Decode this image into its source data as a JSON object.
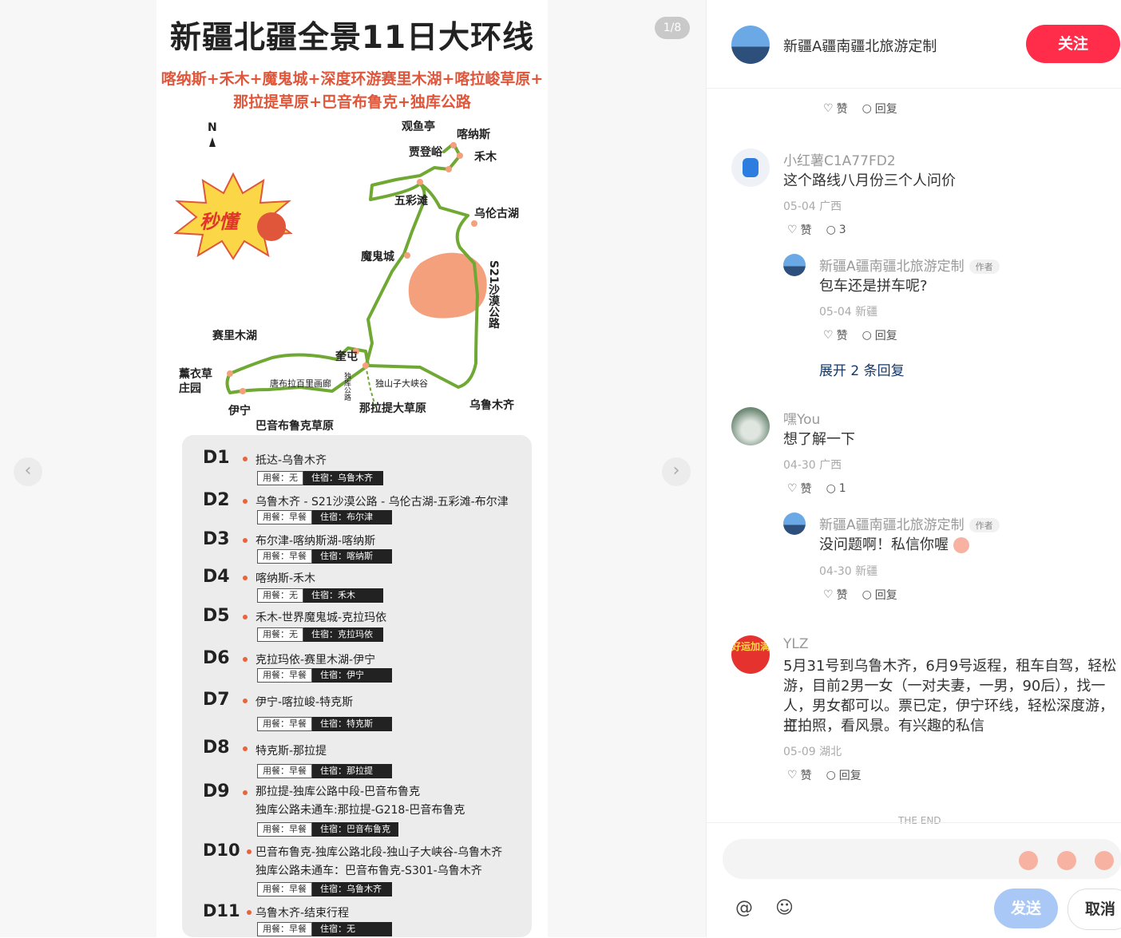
{
  "viewer": {
    "counter": "1/8",
    "prev_icon": "chevron-left-icon",
    "next_icon": "chevron-right-icon"
  },
  "poster": {
    "title": "新疆北疆全景11日大环线",
    "subtitle_line1": "喀纳斯+禾木+魔鬼城+深度环游赛里木湖+喀拉峻草原+",
    "subtitle_line2": "那拉提草原+巴音布鲁克+独库公路",
    "north": "N",
    "badge_text": "秒懂",
    "map_labels": {
      "guanyuting": "观鱼亭",
      "kanasi": "喀纳斯",
      "jiadengyu": "贾登峪",
      "hemu": "禾木",
      "wucaitan": "五彩滩",
      "wulungu": "乌伦古湖",
      "moguicheng": "魔鬼城",
      "s21": "S21沙漠公路",
      "sailimu": "赛里木湖",
      "kuitun": "奎屯",
      "xunyicao": "薰衣草庄园",
      "tangbula": "唐布拉百里画廊",
      "duku": "独库公路",
      "dushanzi": "独山子大峡谷",
      "yining": "伊宁",
      "nalati": "那拉提大草原",
      "bayinbuluke": "巴音布鲁克草原",
      "wulumuqi": "乌鲁木齐"
    },
    "days": [
      {
        "day": "D1",
        "route": "抵达-乌鲁木齐",
        "meal": "用餐：无",
        "stay": "住宿：乌鲁木齐"
      },
      {
        "day": "D2",
        "route": "乌鲁木齐 - S21沙漠公路 - 乌伦古湖-五彩滩-布尔津",
        "meal": "用餐：早餐",
        "stay": "住宿：布尔津"
      },
      {
        "day": "D3",
        "route": "布尔津-喀纳斯湖-喀纳斯",
        "meal": "用餐：早餐",
        "stay": "住宿：喀纳斯"
      },
      {
        "day": "D4",
        "route": "喀纳斯-禾木",
        "meal": "用餐：无",
        "stay": "住宿：禾木"
      },
      {
        "day": "D5",
        "route": "禾木-世界魔鬼城-克拉玛依",
        "meal": "用餐：无",
        "stay": "住宿：克拉玛依"
      },
      {
        "day": "D6",
        "route": "克拉玛依-赛里木湖-伊宁",
        "meal": "用餐：早餐",
        "stay": "住宿：伊宁"
      },
      {
        "day": "D7",
        "route": "伊宁-喀拉峻-特克斯",
        "meal": "用餐：早餐",
        "stay": "住宿：特克斯"
      },
      {
        "day": "D8",
        "route": "特克斯-那拉提",
        "meal": "用餐：早餐",
        "stay": "住宿：那拉提"
      },
      {
        "day": "D9",
        "route": "那拉提-独库公路中段-巴音布鲁克",
        "route2": "独库公路未通车:那拉提-G218-巴音布鲁克",
        "meal": "用餐：早餐",
        "stay": "住宿：巴音布鲁克"
      },
      {
        "day": "D10",
        "route": "巴音布鲁克-独库公路北段-独山子大峡谷-乌鲁木齐",
        "route2": "独库公路未通车：巴音布鲁克-S301-乌鲁木齐",
        "meal": "用餐：早餐",
        "stay": "住宿：乌鲁木齐"
      },
      {
        "day": "D11",
        "route": "乌鲁木齐-结束行程",
        "meal": "用餐：早餐",
        "stay": "住宿：无"
      }
    ]
  },
  "header": {
    "author": "新疆A疆南疆北旅游定制",
    "follow_label": "关注"
  },
  "top_actions": {
    "like": "赞",
    "reply": "回复"
  },
  "comments": [
    {
      "name": "小红薯C1A77FD2",
      "text": "这个路线八月份三个人问价",
      "meta": "05-04 广西",
      "like": "赞",
      "reply_count": "3",
      "reply": {
        "name": "新疆A疆南疆北旅游定制",
        "badge": "作者",
        "text": "包车还是拼车呢?",
        "meta": "05-04 新疆",
        "like": "赞",
        "reply": "回复"
      },
      "expand": "展开 2 条回复"
    },
    {
      "name": "嘿You",
      "text": "想了解一下",
      "meta": "04-30 广西",
      "like": "赞",
      "reply_count": "1",
      "reply": {
        "name": "新疆A疆南疆北旅游定制",
        "badge": "作者",
        "text": "没问题啊！私信你喔",
        "meta": "04-30 新疆",
        "like": "赞",
        "reply": "回复"
      }
    },
    {
      "name": "YLZ",
      "avatar_text": "好运加满",
      "text_lines": [
        "5月31号到乌鲁木齐，6月9号返程，租车自驾，轻松",
        "游，目前2男一女（一对夫妻，一男，90后），找一",
        "人，男女都可以。票已定，伊宁环线，轻松深度游，主",
        "打拍照，看风景。有兴趣的私信"
      ],
      "meta": "05-09 湖北",
      "like": "赞",
      "reply": "回复"
    }
  ],
  "the_end": "THE END",
  "footer": {
    "send_label": "发送",
    "cancel_label": "取消",
    "at_icon": "at-icon",
    "emoji_icon": "smile-icon"
  },
  "colors": {
    "accent": "#ff2d4a",
    "link": "#13386c",
    "send": "#a9c8f5",
    "route_green": "#6fa832",
    "poster_red": "#e0563a"
  }
}
